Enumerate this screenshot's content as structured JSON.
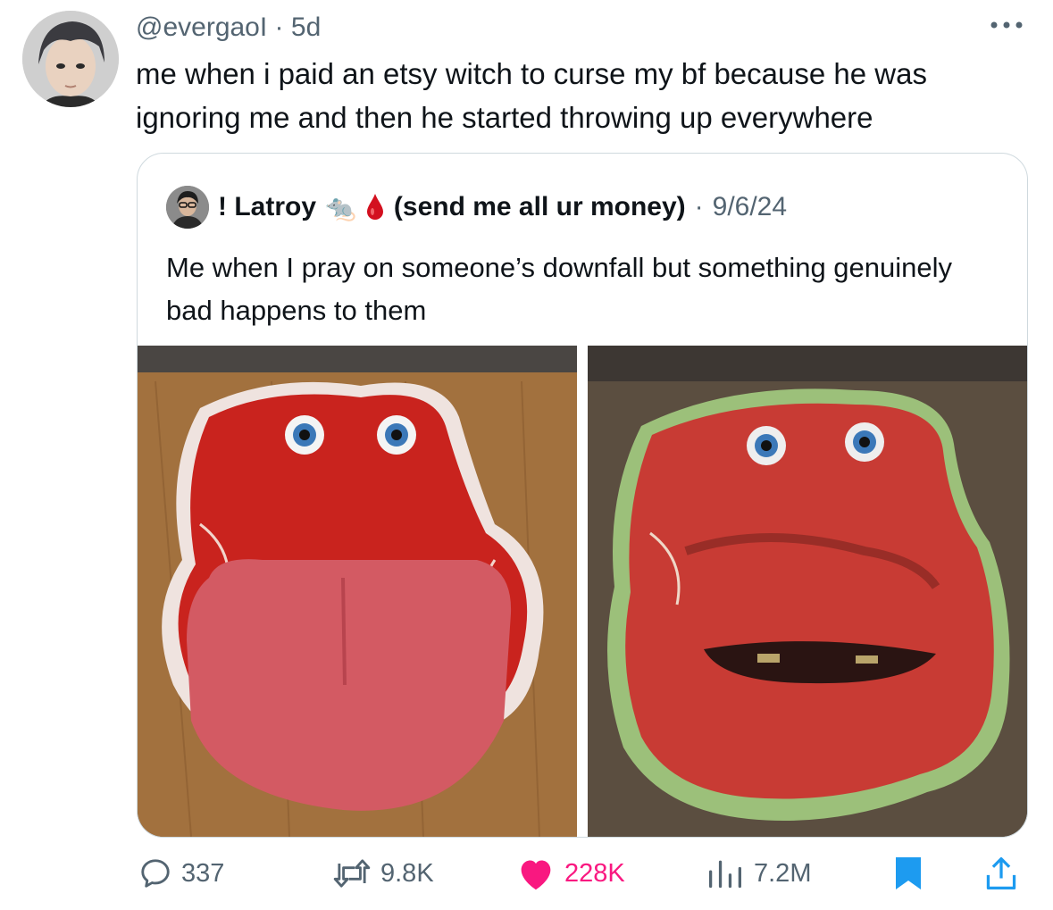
{
  "tweet": {
    "handle": "@evergaoI",
    "separator": "·",
    "time": "5d",
    "text": "me when i paid an etsy witch to curse my bf because he was ignoring me and then he started throwing up everywhere"
  },
  "quoted": {
    "name_prefix": "! Latroy",
    "emoji_rat": "🐀",
    "name_suffix": "(send me all ur money)",
    "separator": "·",
    "date": "9/6/24",
    "text": "Me when I pray on someone’s downfall but something genuinely bad happens to them"
  },
  "actions": {
    "replies": "337",
    "reposts": "9.8K",
    "likes": "228K",
    "views": "7.2M"
  },
  "colors": {
    "like": "#f91880",
    "bookmark": "#1d9bf0",
    "share": "#1d9bf0",
    "muted": "#536471",
    "border": "#cfd9de"
  }
}
